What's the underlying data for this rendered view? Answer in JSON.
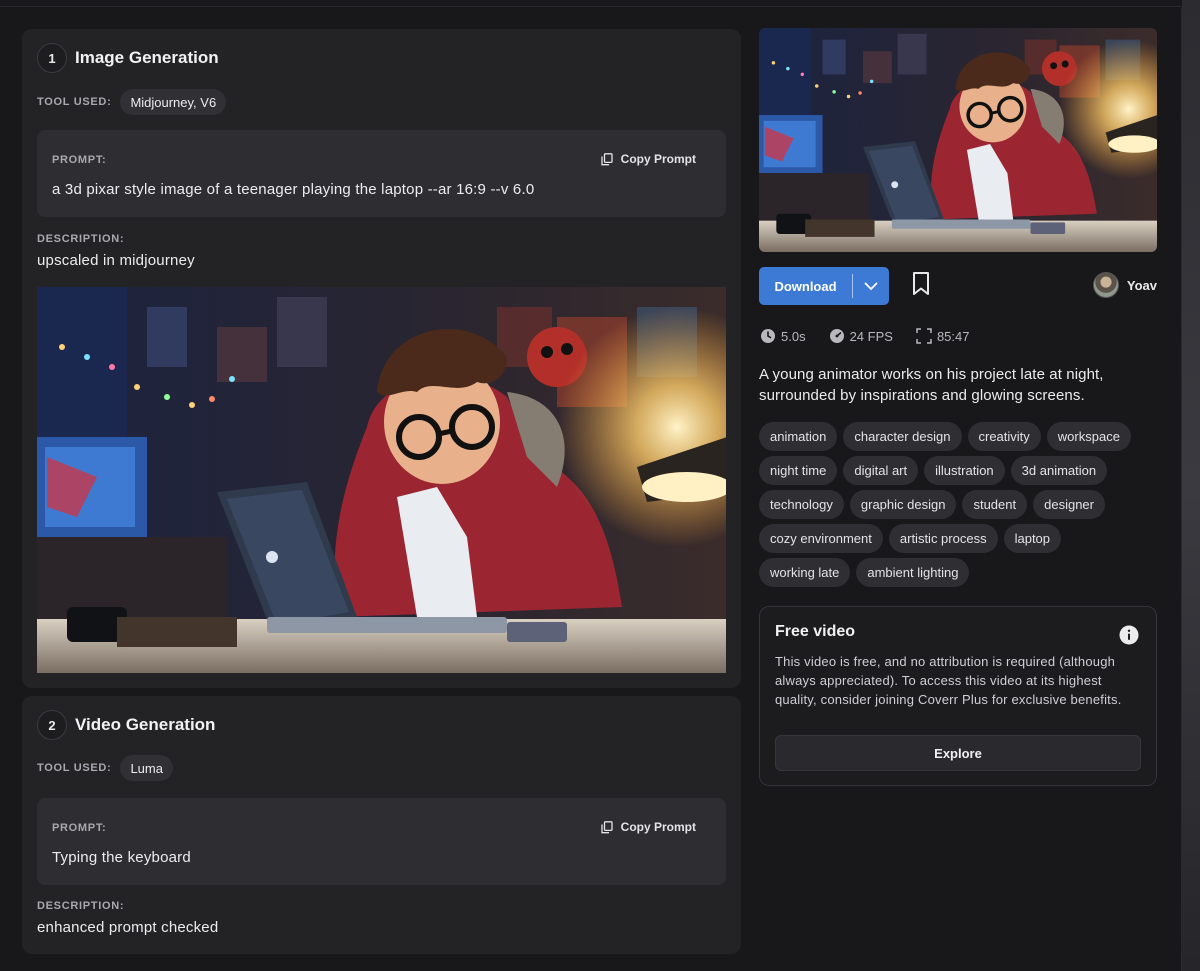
{
  "steps": [
    {
      "number": "1",
      "title": "Image Generation",
      "tool_label": "TOOL USED:",
      "tool": "Midjourney, V6",
      "prompt_label": "PROMPT:",
      "prompt": "a 3d pixar style image of a teenager playing the laptop --ar 16:9 --v 6.0",
      "copy_label": "Copy Prompt",
      "description_label": "DESCRIPTION:",
      "description": "upscaled in midjourney"
    },
    {
      "number": "2",
      "title": "Video Generation",
      "tool_label": "TOOL USED:",
      "tool": "Luma",
      "prompt_label": "PROMPT:",
      "prompt": "Typing the keyboard",
      "copy_label": "Copy Prompt",
      "description_label": "DESCRIPTION:",
      "description": "enhanced prompt checked"
    }
  ],
  "video": {
    "download_label": "Download",
    "author": "Yoav",
    "duration": "5.0s",
    "fps": "24 FPS",
    "aspect": "85:47",
    "summary": "A young animator works on his project late at night, surrounded by inspirations and glowing screens.",
    "tags": [
      "animation",
      "character design",
      "creativity",
      "workspace",
      "night time",
      "digital art",
      "illustration",
      "3d animation",
      "technology",
      "graphic design",
      "student",
      "designer",
      "cozy environment",
      "artistic process",
      "laptop",
      "working late",
      "ambient lighting"
    ]
  },
  "free_video": {
    "title": "Free video",
    "text": "This video is free, and no attribution is required (although always appreciated). To access this video at its highest quality, consider joining Coverr Plus for exclusive benefits.",
    "button": "Explore"
  },
  "colors": {
    "accent": "#3d7ad6",
    "card": "#232326",
    "background": "#18181a"
  },
  "icons": [
    "copy-icon",
    "chevron-down-icon",
    "bookmark-icon",
    "clock-icon",
    "gauge-icon",
    "aspect-ratio-icon",
    "info-icon"
  ]
}
